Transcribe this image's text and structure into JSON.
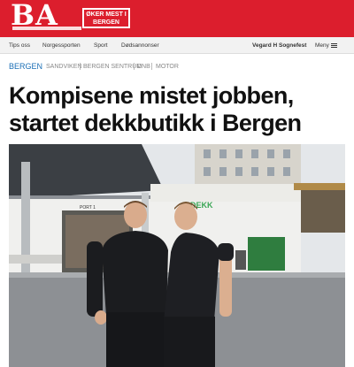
{
  "brand": {
    "logo_text": "BA",
    "logo_tagline": "ØKER MEST I BERGEN",
    "colors": {
      "brand_red": "#dc1e2d",
      "link_blue": "#1b6fb6"
    }
  },
  "nav": {
    "items": [
      "Tips oss",
      "Norgessporten",
      "Sport",
      "Dødsannonser"
    ],
    "user": "Vegard H Sognefest",
    "menu_label": "Meny"
  },
  "article": {
    "primary_tag": "BERGEN",
    "tags": [
      "SANDVIKEN",
      "BERGEN SENTRUM",
      "DNB",
      "MOTOR"
    ],
    "headline_line1": "Kompisene mistet jobben,",
    "headline_line2": "startet dekkbutikk i Bergen",
    "photo": {
      "sign_text": "DEKK",
      "port_label": "PORT 1"
    }
  },
  "icons": {
    "menu": "hamburger-icon"
  }
}
